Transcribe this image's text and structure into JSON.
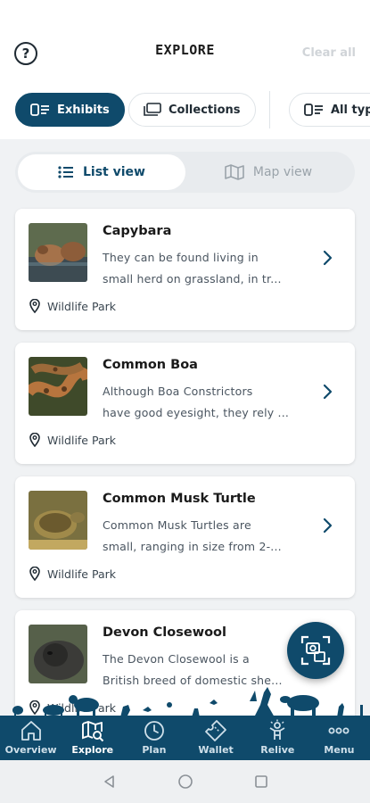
{
  "header": {
    "help_icon": "question-circle-icon",
    "title": "EXPLORE",
    "clear_all": "Clear all"
  },
  "filters": {
    "chips": [
      {
        "label": "Exhibits",
        "icon": "filter-list-icon",
        "active": true
      },
      {
        "label": "Collections",
        "icon": "collections-icon",
        "active": false
      },
      {
        "label": "All typ",
        "icon": "filter-list-icon",
        "active": false
      }
    ]
  },
  "view_toggle": {
    "list_label": "List view",
    "map_label": "Map view"
  },
  "exhibits": [
    {
      "title": "Capybara",
      "desc_line1": "They can be found living in",
      "desc_line2": "small herd on grassland, in tr...",
      "location": "Wildlife Park"
    },
    {
      "title": "Common Boa",
      "desc_line1": "Although Boa Constrictors",
      "desc_line2": "have good eyesight, they rely ...",
      "location": "Wildlife Park"
    },
    {
      "title": "Common Musk Turtle",
      "desc_line1": "Common Musk Turtles are",
      "desc_line2": "small, ranging in size from 2-...",
      "location": "Wildlife Park"
    },
    {
      "title": "Devon Closewool",
      "desc_line1": "The Devon Closewool is a",
      "desc_line2": "British breed of domestic she...",
      "location": "Wildlife Park"
    }
  ],
  "bottom_nav": [
    {
      "label": "Overview",
      "icon": "home-icon",
      "active": false
    },
    {
      "label": "Explore",
      "icon": "map-search-icon",
      "active": true
    },
    {
      "label": "Plan",
      "icon": "clock-icon",
      "active": false
    },
    {
      "label": "Wallet",
      "icon": "ticket-icon",
      "active": false
    },
    {
      "label": "Relive",
      "icon": "celebrate-icon",
      "active": false
    },
    {
      "label": "Menu",
      "icon": "more-dots-icon",
      "active": false
    }
  ],
  "colors": {
    "brand": "#0f4a6b",
    "background": "#f0f2f4",
    "muted": "#9aa3aa"
  }
}
